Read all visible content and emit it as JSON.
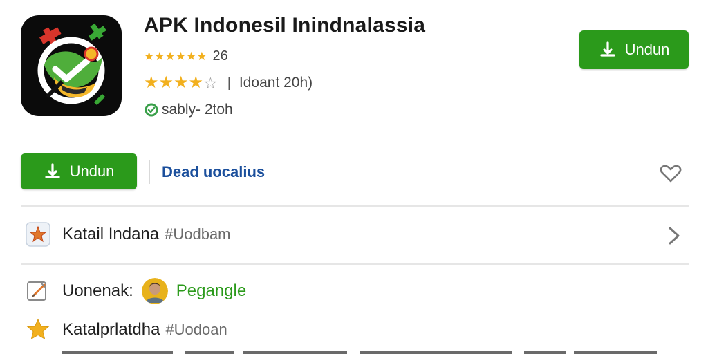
{
  "app": {
    "title": "APK Indonesil Inindnalassia",
    "icon_name": "app-logo-icon"
  },
  "ratings": {
    "small_stars": "★★★★★★",
    "small_count": "26",
    "rating_value": 4,
    "rating_max": 5,
    "rating_text": "Idoant 20h)",
    "safety_text": "sably- 2toh"
  },
  "buttons": {
    "top_download_label": "Undun",
    "main_download_label": "Undun",
    "secondary_link": "Dead uocalius"
  },
  "list": {
    "row1_label": "Katail Indana",
    "row1_sub": "#Uodbam",
    "row2_label": "Uonenak:",
    "row2_dev": "Pegangle",
    "row3_label": "Katalprlatdha",
    "row3_sub": "#Uodoan"
  },
  "colors": {
    "accent_green": "#2b9a1b",
    "link_blue": "#1b4f9c",
    "star_yellow": "#f2b01e"
  }
}
